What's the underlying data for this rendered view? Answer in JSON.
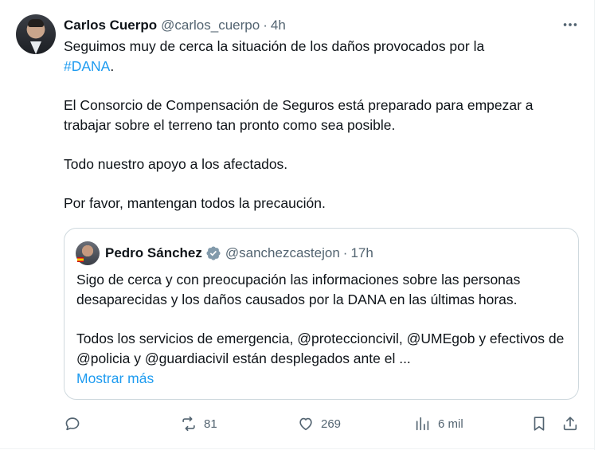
{
  "tweet": {
    "author_name": "Carlos Cuerpo",
    "author_handle": "@carlos_cuerpo",
    "separator": "·",
    "time": "4h",
    "more_label": "•••",
    "line1_text": "Seguimos muy de cerca la situación de los daños provocados por la",
    "hashtag": "#DANA",
    "hashtag_suffix": ".",
    "paragraph2": "El Consorcio de Compensación de Seguros está preparado para empezar a trabajar sobre el terreno tan pronto como sea posible.",
    "paragraph3": "Todo nuestro apoyo a los afectados.",
    "paragraph4": "Por favor, mantengan todos la precaución."
  },
  "quote": {
    "author_name": "Pedro Sánchez",
    "author_handle": "@sanchezcastejon",
    "separator": "·",
    "time": "17h",
    "paragraph1": "Sigo de cerca y con preocupación las informaciones sobre las personas desaparecidas y los daños causados por la DANA en las últimas horas.",
    "paragraph2": "Todos los servicios de emergencia, @proteccioncivil, @UMEgob y efectivos de @policia y @guardiacivil están desplegados ante el ...",
    "show_more": "Mostrar más"
  },
  "actions": {
    "reply_icon": "reply-icon",
    "retweets": "81",
    "likes": "269",
    "views": "6 mil",
    "bookmark_icon": "bookmark-icon",
    "share_icon": "share-icon"
  },
  "colors": {
    "accent": "#1d9bf0",
    "secondary_text": "#536471",
    "verified_badge": "#829aab"
  }
}
